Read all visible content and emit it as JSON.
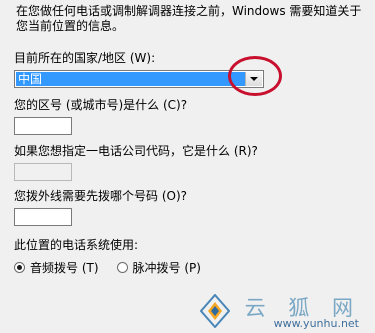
{
  "intro_text": "在您做任何电话或调制解调器连接之前，Windows 需要知道关于您当前位置的信息。",
  "country": {
    "label": "目前所在的国家/地区 (W):",
    "selected": "中国"
  },
  "area_code": {
    "label": "您的区号 (或城市号)是什么 (C)?",
    "value": ""
  },
  "carrier_code": {
    "label": "如果您想指定一电话公司代码，它是什么 (R)?",
    "value": ""
  },
  "outside_line": {
    "label": "您拨外线需要先拨哪个号码 (O)?",
    "value": ""
  },
  "dialing": {
    "label": "此位置的电话系统使用:",
    "options": [
      {
        "label": "音频拨号 (T)",
        "checked": true
      },
      {
        "label": "脉冲拨号 (P)",
        "checked": false
      }
    ]
  },
  "watermark": {
    "text": "云 狐 网",
    "url": "www.yunhu.net"
  },
  "colors": {
    "selection": "#3399ff",
    "annotation_ring": "#c8102e"
  }
}
